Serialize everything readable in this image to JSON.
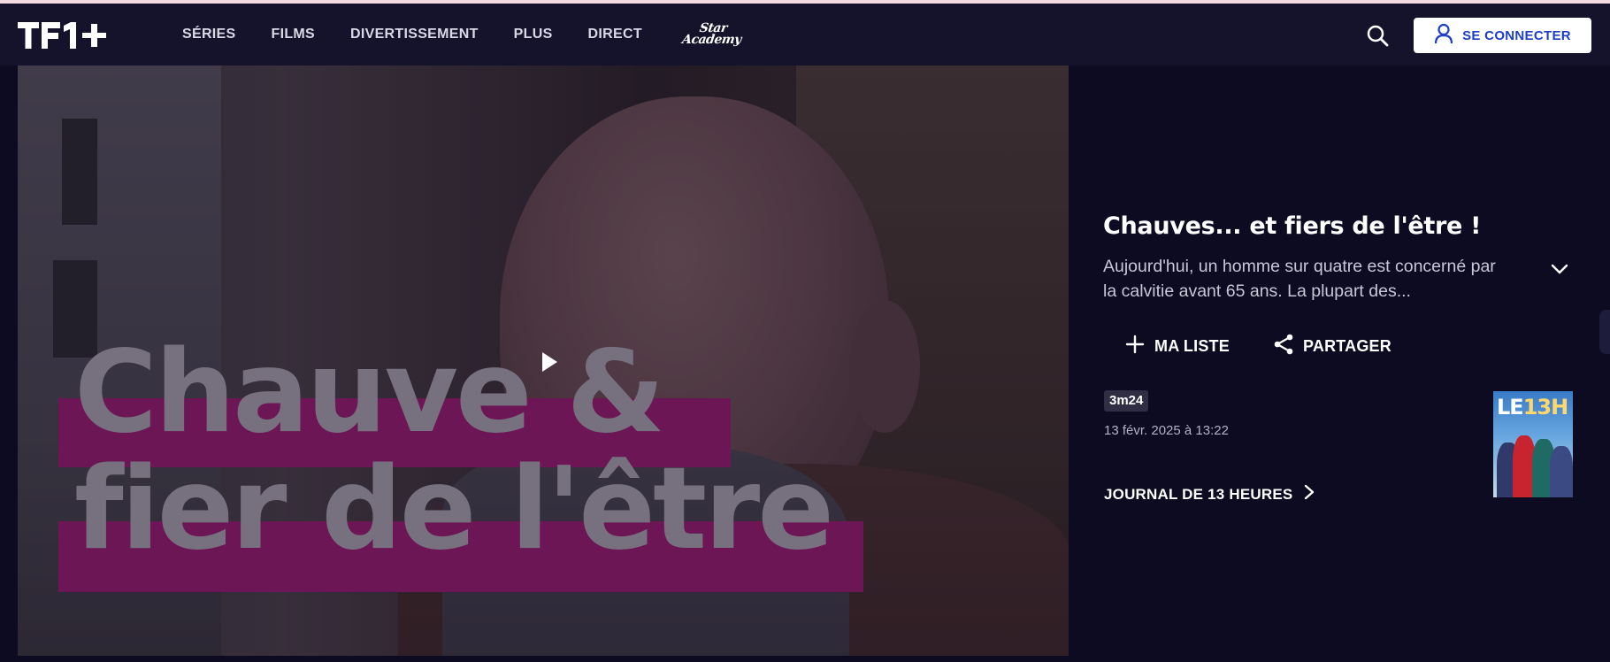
{
  "header": {
    "logo_alt": "TF1+",
    "nav": [
      "SÉRIES",
      "FILMS",
      "DIVERTISSEMENT",
      "PLUS",
      "DIRECT"
    ],
    "star_academy": [
      "Star",
      "Academy"
    ],
    "connect_label": "SE CONNECTER"
  },
  "video": {
    "overlay_title_line1": "Chauve &",
    "overlay_title_line2": "fier de l'être"
  },
  "info": {
    "title": "Chauves... et fiers de l'être !",
    "description": "Aujourd'hui, un homme sur quatre est concerné par la calvitie avant 65 ans. La plupart des...",
    "actions": {
      "my_list": "MA LISTE",
      "share": "PARTAGER"
    },
    "duration": "3m24",
    "date": "13 févr. 2025 à 13:22",
    "program_link": "JOURNAL DE 13 HEURES",
    "thumbnail_label_a": "LE",
    "thumbnail_label_b": "13H"
  },
  "colors": {
    "header_bg": "#14132b",
    "page_bg": "#0c0b22",
    "accent_blue": "#1d3fc7",
    "title_band": "#6d1655"
  }
}
